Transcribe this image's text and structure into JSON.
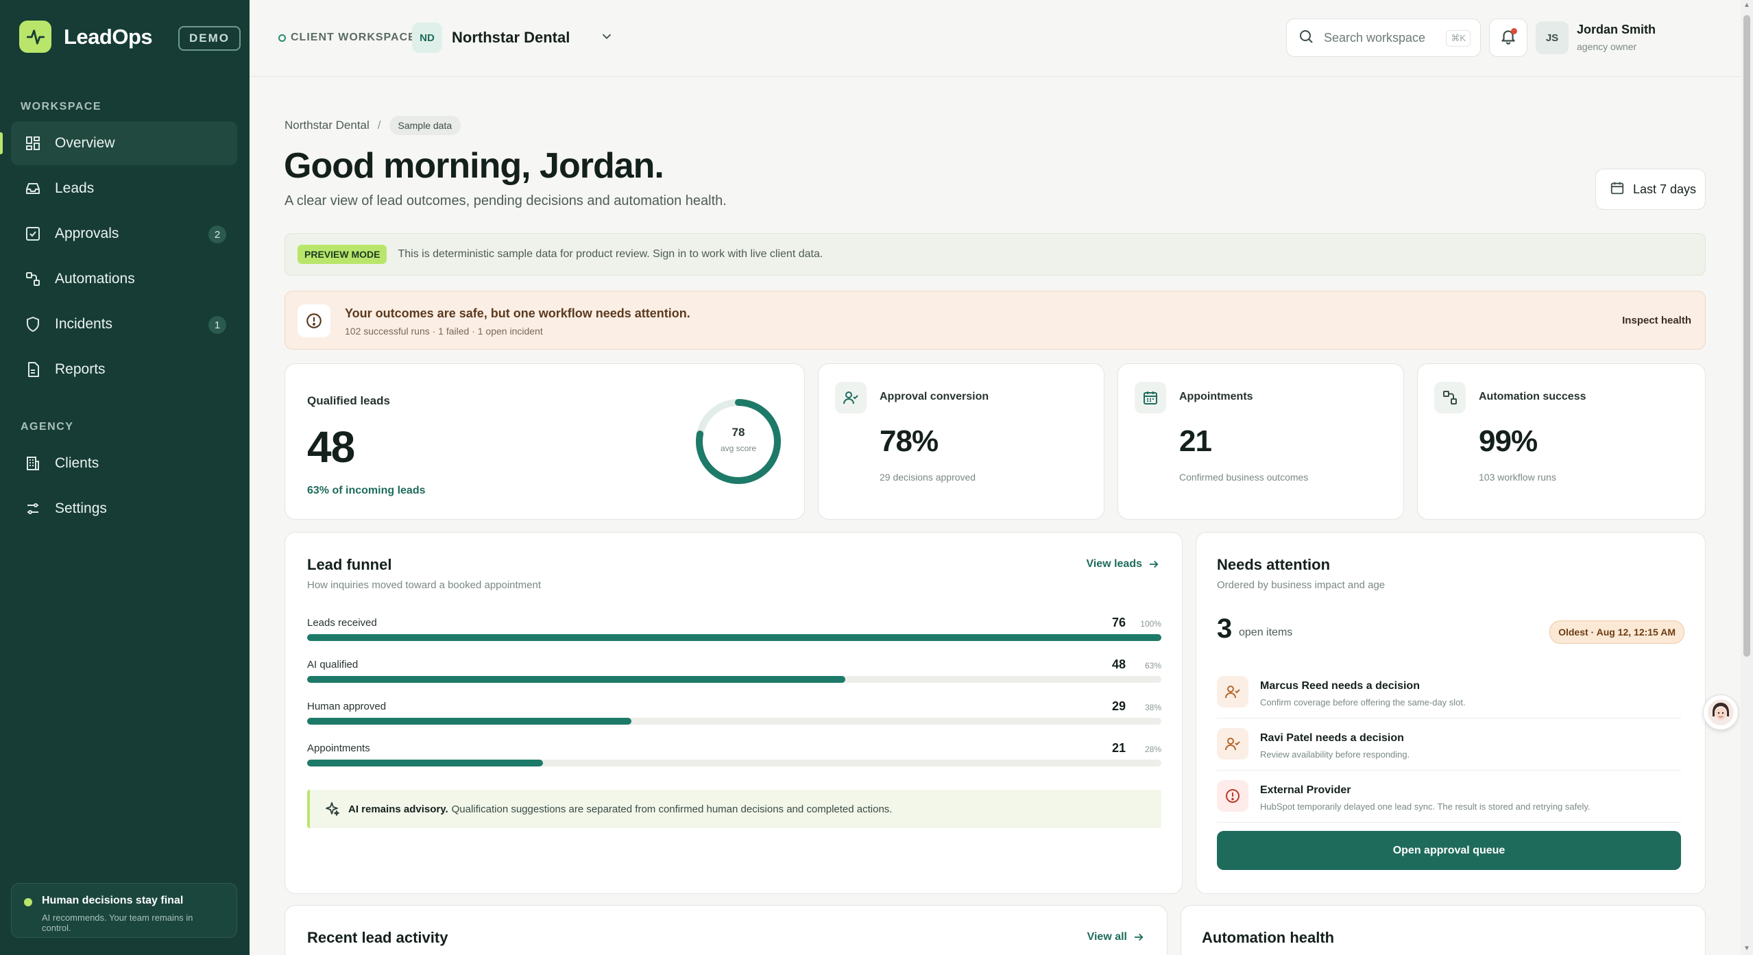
{
  "brand": {
    "name": "LeadOps",
    "badge": "DEMO"
  },
  "sidebar": {
    "sections": [
      {
        "label": "WORKSPACE"
      },
      {
        "label": "AGENCY"
      }
    ],
    "items": [
      {
        "label": "Overview",
        "icon": "grid-icon",
        "active": true
      },
      {
        "label": "Leads",
        "icon": "inbox-icon"
      },
      {
        "label": "Approvals",
        "icon": "check-square-icon",
        "count": "2"
      },
      {
        "label": "Automations",
        "icon": "workflow-icon"
      },
      {
        "label": "Incidents",
        "icon": "shield-icon",
        "count": "1"
      },
      {
        "label": "Reports",
        "icon": "report-icon"
      },
      {
        "label": "Clients",
        "icon": "building-icon"
      },
      {
        "label": "Settings",
        "icon": "sliders-icon"
      }
    ],
    "footer": {
      "title": "Human decisions stay final",
      "subtitle": "AI recommends. Your team remains in control."
    }
  },
  "topbar": {
    "workspace_label": "CLIENT WORKSPACE",
    "workspace_initials": "ND",
    "workspace_name": "Northstar Dental",
    "search_placeholder": "Search workspace",
    "search_shortcut": "⌘K",
    "user": {
      "initials": "JS",
      "name": "Jordan Smith",
      "role": "agency owner"
    }
  },
  "header": {
    "breadcrumb": {
      "root": "Northstar Dental",
      "separator": "/",
      "pill": "Sample data"
    },
    "greeting": "Good morning, Jordan.",
    "subtitle": "A clear view of lead outcomes, pending decisions and automation health.",
    "date_range": "Last 7 days"
  },
  "preview": {
    "tag": "PREVIEW MODE",
    "text": "This is deterministic sample data for product review. Sign in to work with live client data."
  },
  "alert": {
    "title": "Your outcomes are safe, but one workflow needs attention.",
    "detail": "102 successful runs · 1 failed · 1 open incident",
    "action": "Inspect health"
  },
  "kpis": {
    "qualified": {
      "label": "Qualified leads",
      "value": "48",
      "note": "63% of incoming leads",
      "score": "78",
      "score_label": "avg score",
      "score_fraction": 0.78
    },
    "approval": {
      "label": "Approval conversion",
      "value": "78%",
      "note": "29 decisions approved"
    },
    "appointments": {
      "label": "Appointments",
      "value": "21",
      "note": "Confirmed business outcomes"
    },
    "automation": {
      "label": "Automation success",
      "value": "99%",
      "note": "103 workflow runs"
    }
  },
  "funnel": {
    "title": "Lead funnel",
    "subtitle": "How inquiries moved toward a booked appointment",
    "link": "View leads",
    "rows": [
      {
        "label": "Leads received",
        "value": "76",
        "pct": "100%",
        "fraction": 1.0
      },
      {
        "label": "AI qualified",
        "value": "48",
        "pct": "63%",
        "fraction": 0.63
      },
      {
        "label": "Human approved",
        "value": "29",
        "pct": "38%",
        "fraction": 0.38
      },
      {
        "label": "Appointments",
        "value": "21",
        "pct": "28%",
        "fraction": 0.276
      }
    ],
    "advisory_bold": "AI remains advisory.",
    "advisory_text": "Qualification suggestions are separated from confirmed human decisions and completed actions."
  },
  "attention": {
    "title": "Needs attention",
    "subtitle": "Ordered by business impact and age",
    "count": "3",
    "count_label": "open items",
    "oldest": "Oldest · Aug 12, 12:15 AM",
    "items": [
      {
        "title": "Marcus Reed needs a decision",
        "subtitle": "Confirm coverage before offering the same-day slot.",
        "icon": "user-check-icon"
      },
      {
        "title": "Ravi Patel needs a decision",
        "subtitle": "Review availability before responding.",
        "icon": "user-check-icon"
      },
      {
        "title": "External Provider",
        "subtitle": "HubSpot temporarily delayed one lead sync. The result is stored and retrying safely.",
        "icon": "alert-circle-icon"
      }
    ],
    "button": "Open approval queue"
  },
  "recent": {
    "title": "Recent lead activity",
    "link": "View all"
  },
  "automation_health": {
    "title": "Automation health"
  },
  "colors": {
    "sidebar": "#163c35",
    "accent": "#b9e66a",
    "primary": "#1e6b5b",
    "warning_bg": "#fbeee4"
  }
}
